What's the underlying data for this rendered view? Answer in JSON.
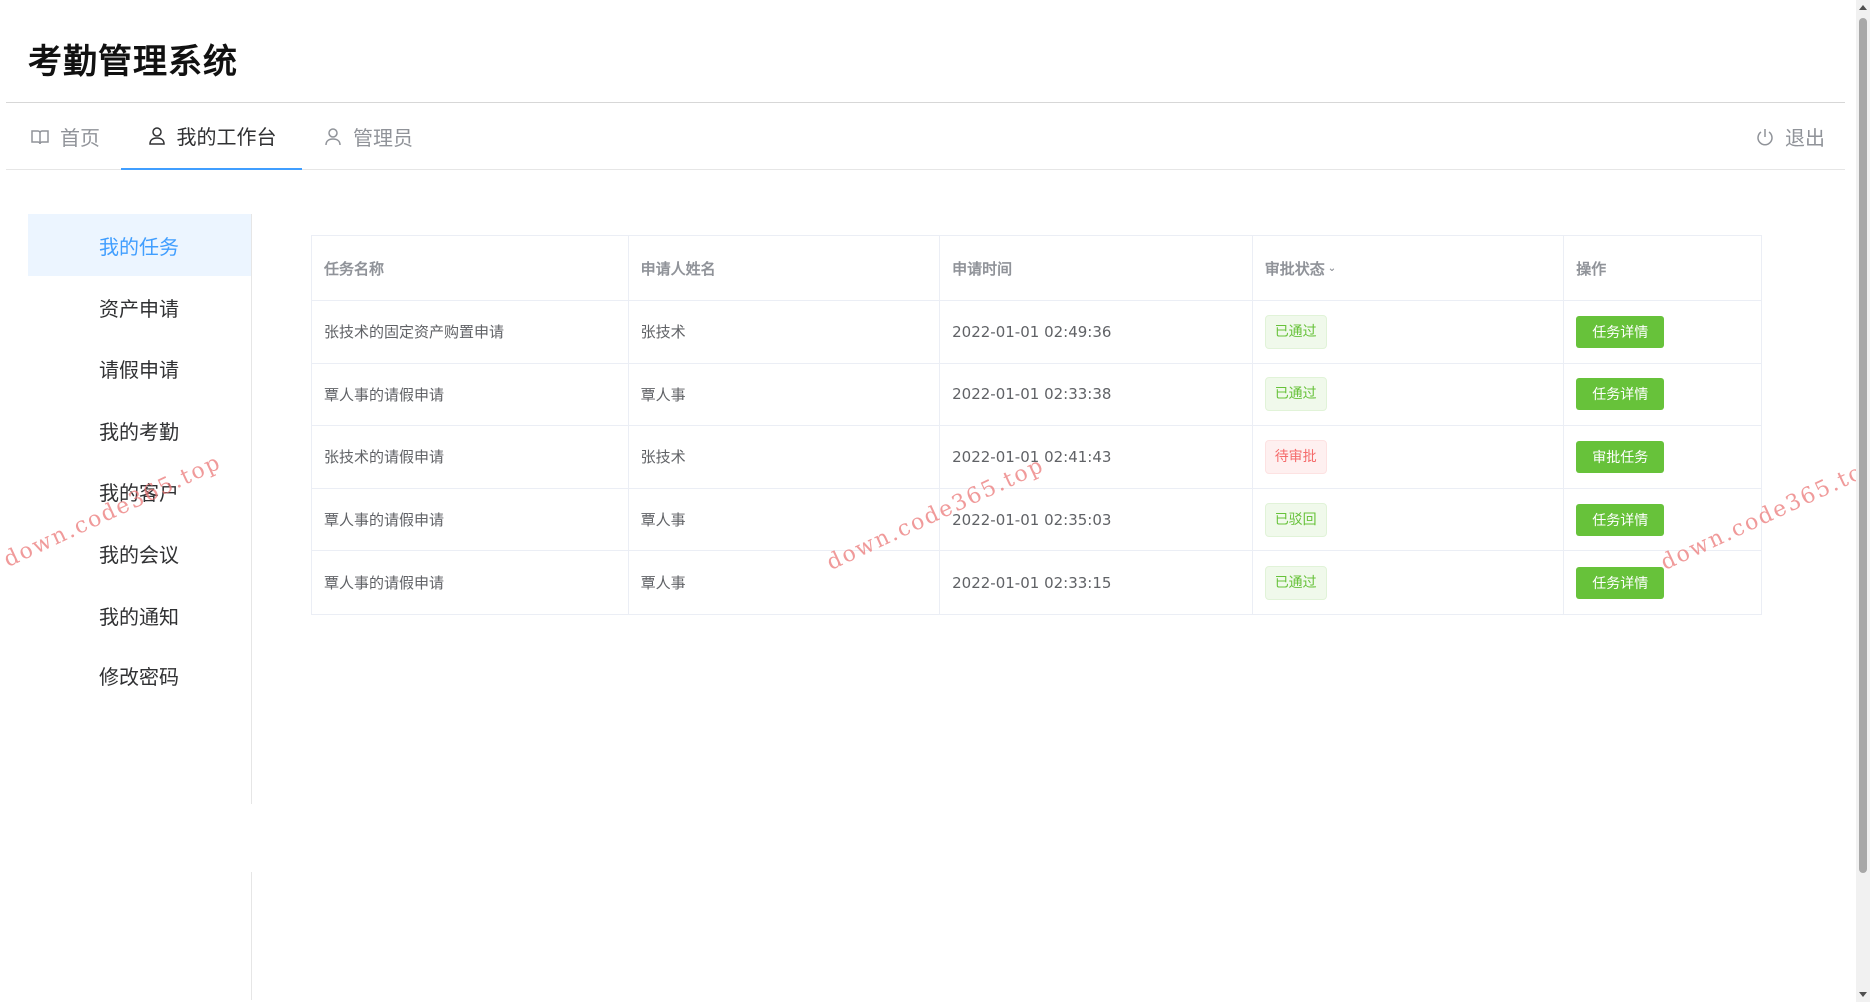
{
  "app": {
    "title": "考勤管理系统"
  },
  "nav": {
    "home": "首页",
    "workbench": "我的工作台",
    "admin": "管理员",
    "logout": "退出"
  },
  "sidebar": {
    "items": [
      {
        "label": "我的任务",
        "active": true
      },
      {
        "label": "资产申请"
      },
      {
        "label": "请假申请"
      },
      {
        "label": "我的考勤"
      },
      {
        "label": "我的客户"
      },
      {
        "label": "我的会议"
      },
      {
        "label": "我的通知"
      },
      {
        "label": "修改密码"
      }
    ]
  },
  "table": {
    "headers": [
      "任务名称",
      "申请人姓名",
      "申请时间",
      "审批状态",
      "操作"
    ],
    "rows": [
      {
        "name": "张技术的固定资产购置申请",
        "applicant": "张技术",
        "time": "2022-01-01 02:49:36",
        "status": "已通过",
        "status_type": "success",
        "action": "任务详情"
      },
      {
        "name": "覃人事的请假申请",
        "applicant": "覃人事",
        "time": "2022-01-01 02:33:38",
        "status": "已通过",
        "status_type": "success",
        "action": "任务详情"
      },
      {
        "name": "张技术的请假申请",
        "applicant": "张技术",
        "time": "2022-01-01 02:41:43",
        "status": "待审批",
        "status_type": "danger",
        "action": "审批任务"
      },
      {
        "name": "覃人事的请假申请",
        "applicant": "覃人事",
        "time": "2022-01-01 02:35:03",
        "status": "已驳回",
        "status_type": "success",
        "action": "任务详情"
      },
      {
        "name": "覃人事的请假申请",
        "applicant": "覃人事",
        "time": "2022-01-01 02:33:15",
        "status": "已通过",
        "status_type": "success",
        "action": "任务详情"
      }
    ]
  },
  "watermark": {
    "text": "down.code365.top"
  },
  "colors": {
    "accent": "#409eff",
    "success": "#67c23a",
    "danger": "#f56c6c"
  }
}
